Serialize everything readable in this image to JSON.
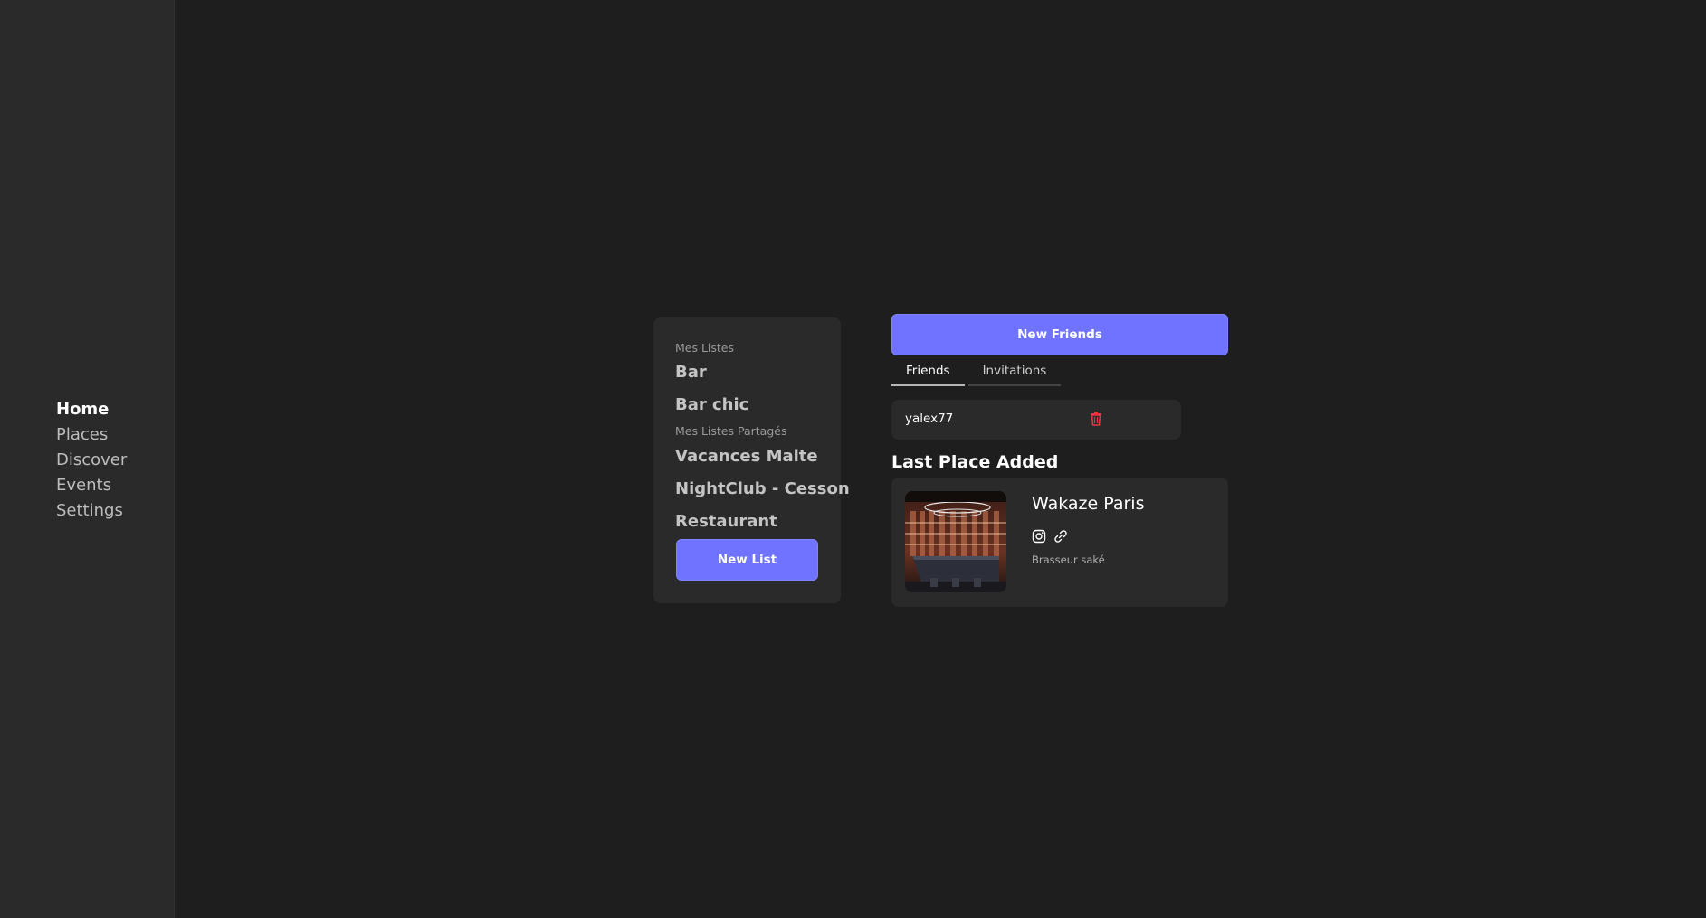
{
  "sidebar": {
    "items": [
      {
        "label": "Home",
        "active": true
      },
      {
        "label": "Places"
      },
      {
        "label": "Discover"
      },
      {
        "label": "Events"
      },
      {
        "label": "Settings"
      }
    ]
  },
  "lists": {
    "my_lists_label": "Mes Listes",
    "my_lists": [
      "Bar",
      "Bar chic"
    ],
    "shared_lists_label": "Mes Listes Partagés",
    "shared_lists": [
      "Vacances Malte",
      "NightClub - Cesson",
      "Restaurant"
    ],
    "new_list_button": "New List"
  },
  "friends": {
    "new_friends_button": "New Friends",
    "tabs": [
      "Friends",
      "Invitations"
    ],
    "active_tab": "Friends",
    "items": [
      {
        "name": "yalex77"
      }
    ]
  },
  "last_place": {
    "title": "Last Place Added",
    "name": "Wakaze Paris",
    "category": "Brasseur saké",
    "icons": [
      "instagram-icon",
      "link-icon"
    ]
  },
  "colors": {
    "accent": "#6f73ff",
    "background": "#1e1e1e",
    "card": "#2a2a2a",
    "danger": "#e0393e"
  }
}
